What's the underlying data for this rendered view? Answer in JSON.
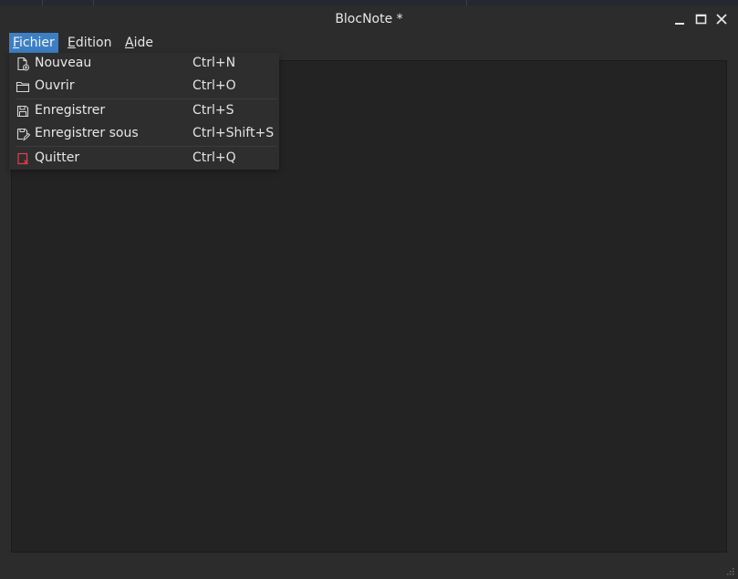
{
  "window": {
    "title": "BlocNote *",
    "controls": {
      "minimize_icon": "minimize-icon",
      "maximize_icon": "maximize-icon",
      "close_icon": "close-icon"
    }
  },
  "menubar": {
    "items": [
      {
        "label": "Fichier",
        "active": true
      },
      {
        "label": "Edition",
        "active": false
      },
      {
        "label": "Aide",
        "active": false
      }
    ]
  },
  "file_menu": {
    "items": [
      {
        "label": "Nouveau",
        "shortcut": "Ctrl+N",
        "icon": "new-file-icon"
      },
      {
        "label": "Ouvrir",
        "shortcut": "Ctrl+O",
        "icon": "folder-icon"
      },
      {
        "label": "Enregistrer",
        "shortcut": "Ctrl+S",
        "icon": "save-icon"
      },
      {
        "label": "Enregistrer sous",
        "shortcut": "Ctrl+Shift+S",
        "icon": "save-as-icon"
      },
      {
        "label": "Quitter",
        "shortcut": "Ctrl+Q",
        "icon": "quit-icon"
      }
    ]
  },
  "colors": {
    "accent": "#3d7fc4",
    "background": "#2c2c2c",
    "editor_background": "#232323",
    "menu_background": "#2e2e2e",
    "quit_icon": "#e0404a"
  }
}
